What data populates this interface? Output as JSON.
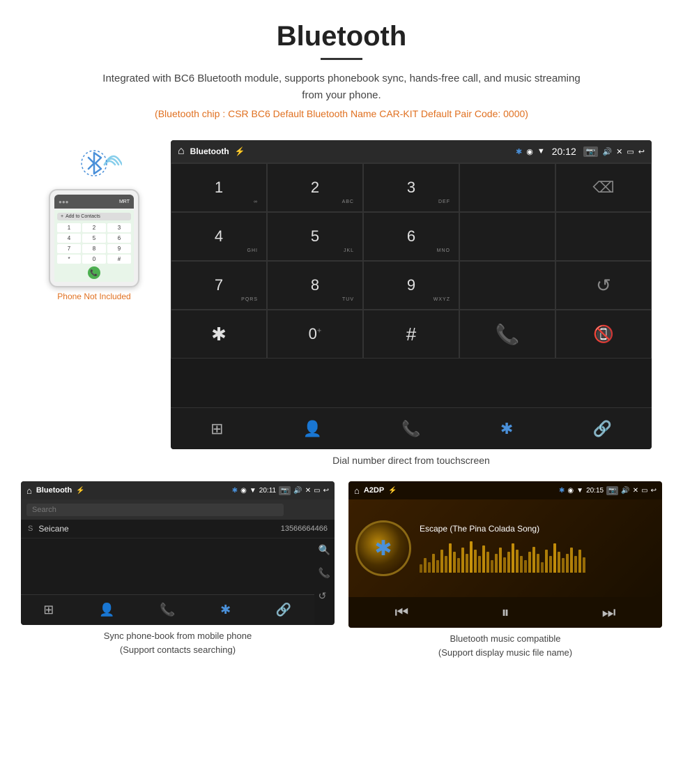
{
  "page": {
    "title": "Bluetooth",
    "subtitle": "Integrated with BC6 Bluetooth module, supports phonebook sync, hands-free call, and music streaming from your phone.",
    "spec_line": "(Bluetooth chip : CSR BC6    Default Bluetooth Name CAR-KIT    Default Pair Code: 0000)",
    "dial_caption": "Dial number direct from touchscreen",
    "phone_not_included": "Phone Not Included"
  },
  "car_screen_main": {
    "status_app": "Bluetooth",
    "status_time": "20:12",
    "keypad": [
      {
        "label": "1",
        "sub": "∞",
        "row": 1
      },
      {
        "label": "2",
        "sub": "ABC",
        "row": 1
      },
      {
        "label": "3",
        "sub": "DEF",
        "row": 1
      },
      {
        "label": "4",
        "sub": "GHI",
        "row": 2
      },
      {
        "label": "5",
        "sub": "JKL",
        "row": 2
      },
      {
        "label": "6",
        "sub": "MNO",
        "row": 2
      },
      {
        "label": "7",
        "sub": "PQRS",
        "row": 3
      },
      {
        "label": "8",
        "sub": "TUV",
        "row": 3
      },
      {
        "label": "9",
        "sub": "WXYZ",
        "row": 3
      },
      {
        "label": "*",
        "sub": "",
        "row": 4
      },
      {
        "label": "0",
        "sub": "+",
        "row": 4
      },
      {
        "label": "#",
        "sub": "",
        "row": 4
      }
    ]
  },
  "phonebook_screen": {
    "status_app": "Bluetooth",
    "status_time": "20:11",
    "search_placeholder": "Search",
    "contact": {
      "letter": "S",
      "name": "Seicane",
      "number": "13566664466"
    },
    "caption_line1": "Sync phone-book from mobile phone",
    "caption_line2": "(Support contacts searching)"
  },
  "music_screen": {
    "status_app": "A2DP",
    "status_time": "20:15",
    "song_title": "Escape (The Pina Colada Song)",
    "viz_bars": [
      8,
      14,
      10,
      18,
      12,
      22,
      16,
      28,
      20,
      14,
      24,
      18,
      30,
      22,
      16,
      26,
      20,
      12,
      18,
      24,
      15,
      20,
      28,
      22,
      16,
      12,
      20,
      25,
      18,
      10,
      22,
      16,
      28,
      20,
      14,
      18,
      24,
      16,
      22,
      15
    ],
    "caption_line1": "Bluetooth music compatible",
    "caption_line2": "(Support display music file name)"
  }
}
